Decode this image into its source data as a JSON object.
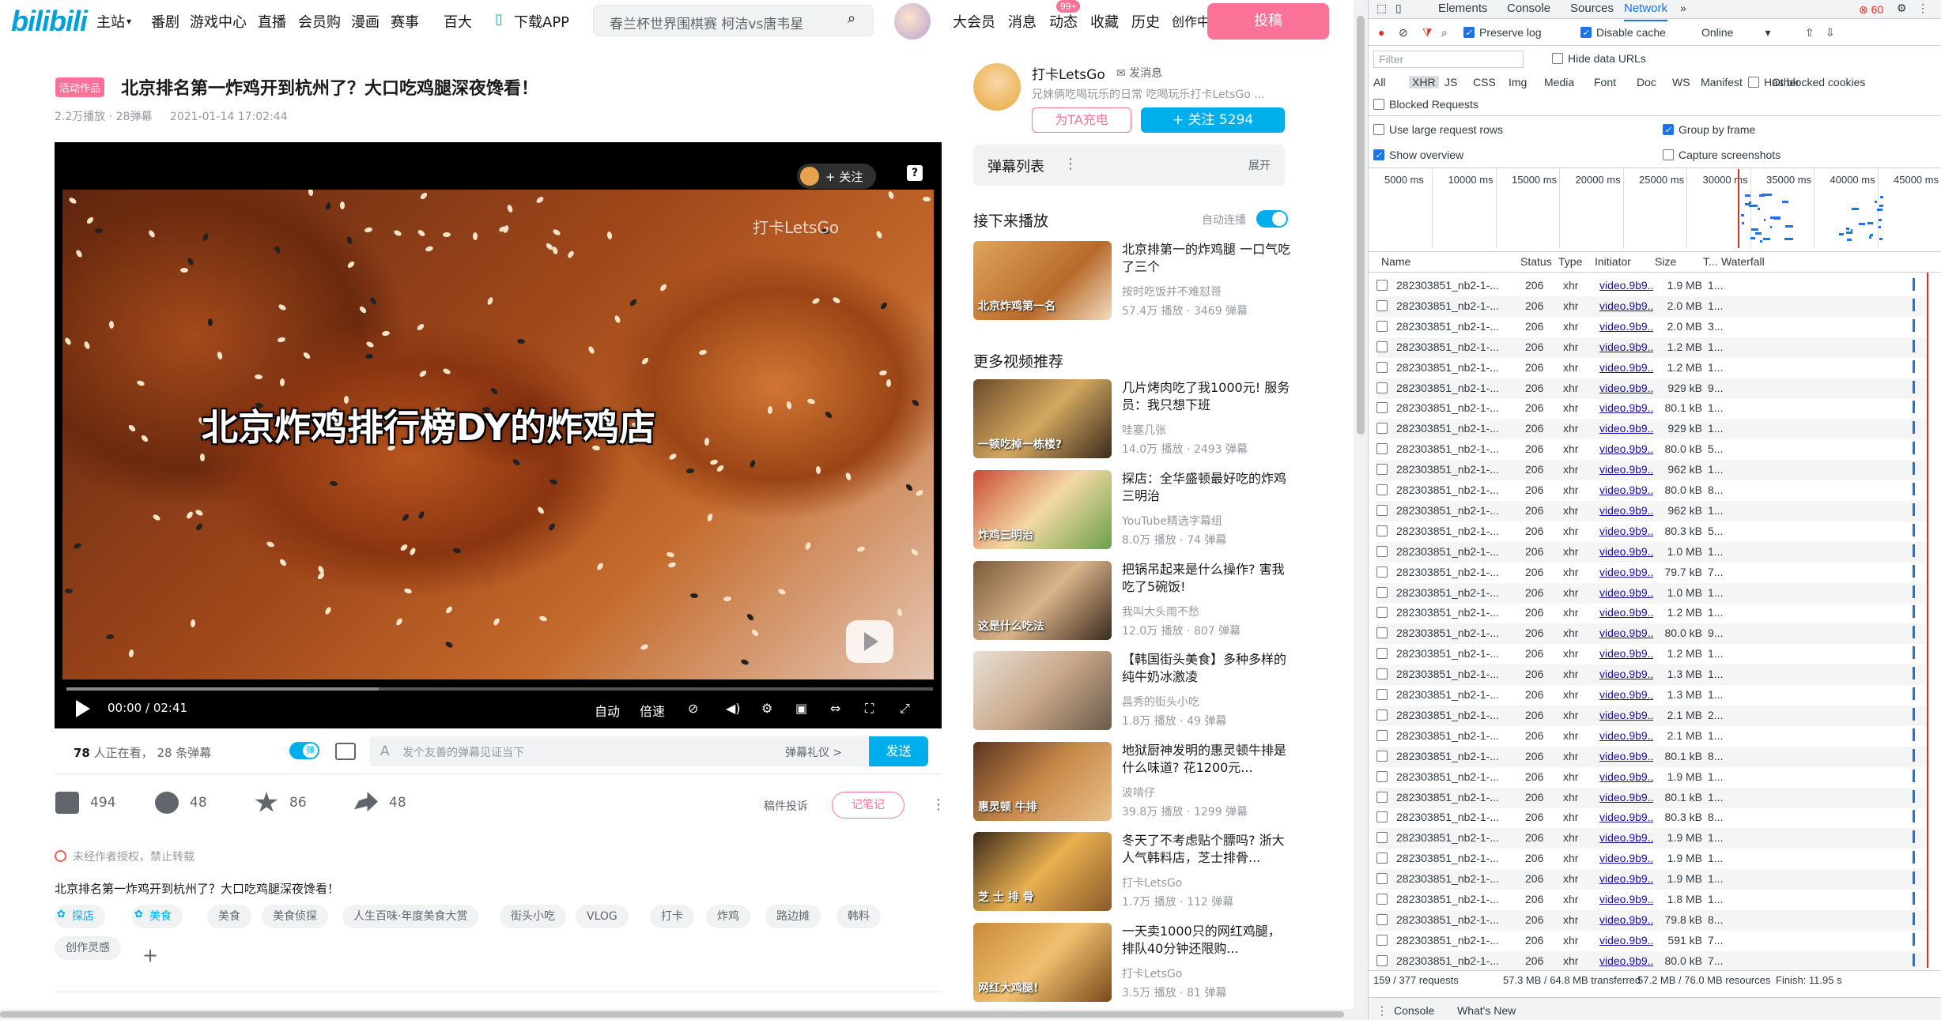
{
  "header": {
    "logo": "bilibili",
    "nav": [
      "主站",
      "番剧",
      "游戏中心",
      "直播",
      "会员购",
      "漫画",
      "赛事",
      "百大",
      "下载APP"
    ],
    "search_placeholder": "春兰杯世界围棋赛 柯洁vs唐韦星",
    "right_nav": [
      "大会员",
      "消息",
      "动态",
      "收藏",
      "历史",
      "创作中心"
    ],
    "dynamic_badge": "99+",
    "post_button": "投稿"
  },
  "video": {
    "activity_tag": "活动作品",
    "title": "北京排名第一炸鸡开到杭州了？大口吃鸡腿深夜馋看！",
    "plays": "2.2万播放",
    "danmaku_count": "28弹幕",
    "date": "2021-01-14 17:02:44",
    "subtitle_text": "北京炸鸡排行榜DY的炸鸡店",
    "watermark": "打卡LetsGo",
    "player_follow": "+ 关注",
    "time_current": "00:00",
    "time_total": "02:41",
    "progress_buffered": 0.36,
    "controls": [
      "自动",
      "倍速"
    ]
  },
  "danmaku_bar": {
    "watching_count": "78",
    "watching_label": "人正在看，",
    "danmaku_total": "28 条弹幕",
    "placeholder": "发个友善的弹幕见证当下",
    "etiquette": "弹幕礼仪 >",
    "send": "发送"
  },
  "actions": {
    "like": "494",
    "coin": "48",
    "favorite": "86",
    "share": "48",
    "report": "稿件投诉",
    "note": "记笔记"
  },
  "copyright_notice": "未经作者授权，禁止转载",
  "description": "北京排名第一炸鸡开到杭州了？大口吃鸡腿深夜馋看！",
  "tags": [
    {
      "label": "探店",
      "blue": true
    },
    {
      "label": "美食",
      "blue": true
    },
    {
      "label": "美食",
      "blue": false
    },
    {
      "label": "美食侦探",
      "blue": false
    },
    {
      "label": "人生百味·年度美食大赏",
      "blue": false
    },
    {
      "label": "街头小吃",
      "blue": false
    },
    {
      "label": "VLOG",
      "blue": false
    },
    {
      "label": "打卡",
      "blue": false
    },
    {
      "label": "炸鸡",
      "blue": false
    },
    {
      "label": "路边摊",
      "blue": false
    },
    {
      "label": "韩料",
      "blue": false
    },
    {
      "label": "创作灵感",
      "blue": false
    }
  ],
  "uploader": {
    "name": "打卡LetsGo",
    "message": "发消息",
    "sign": "兄妹俩吃喝玩乐的日常 吃喝玩乐打卡LetsGo ...",
    "charge": "为TA充电",
    "follow": "+ 关注 5294"
  },
  "danmaku_list": {
    "title": "弹幕列表",
    "expand": "展开"
  },
  "next_up": {
    "heading": "接下来播放",
    "autoplay": "自动连播"
  },
  "more_heading": "更多视频推荐",
  "recommendations": [
    {
      "title": "北京排第一的炸鸡腿 一口气吃了三个",
      "author": "按时吃饭并不难怼哥",
      "stats": "57.4万 播放 · 3469 弹幕",
      "thumb_text": "北京炸鸡第一名"
    },
    {
      "title": "几片烤肉吃了我1000元! 服务员：我只想下班",
      "author": "哇塞几张",
      "stats": "14.0万 播放 · 2493 弹幕",
      "thumb_text": "一顿吃掉一栋楼?"
    },
    {
      "title": "探店：全华盛顿最好吃的炸鸡三明治",
      "author": "YouTube精选字幕组",
      "stats": "8.0万 播放 · 74 弹幕",
      "thumb_text": "炸鸡三明治"
    },
    {
      "title": "把锅吊起来是什么操作? 害我吃了5碗饭!",
      "author": "我叫大头雨不愁",
      "stats": "12.0万 播放 · 807 弹幕",
      "thumb_text": "这是什么吃法"
    },
    {
      "title": "【韩国街头美食】多种多样的纯牛奶冰激凌",
      "author": "昌秀的街头小吃",
      "stats": "1.8万 播放 · 49 弹幕",
      "thumb_text": ""
    },
    {
      "title": "地狱厨神发明的惠灵顿牛排是什么味道? 花1200元...",
      "author": "波啃仔",
      "stats": "39.8万 播放 · 1299 弹幕",
      "thumb_text": "惠灵顿 牛排"
    },
    {
      "title": "冬天了不考虑贴个膘吗? 浙大人气韩料店，芝士排骨...",
      "author": "打卡LetsGo",
      "stats": "1.7万 播放 · 112 弹幕",
      "thumb_text": "芝 士 排 骨"
    },
    {
      "title": "一天卖1000只的网红鸡腿，排队40分钟还限购...",
      "author": "打卡LetsGo",
      "stats": "3.5万 播放 · 81 弹幕",
      "thumb_text": "网红大鸡腿!"
    }
  ],
  "devtools": {
    "tabs": [
      "Elements",
      "Console",
      "Sources",
      "Network"
    ],
    "active_tab": "Network",
    "error_count": "60",
    "preserve_log": "Preserve log",
    "disable_cache": "Disable cache",
    "throttle": "Online",
    "filter_placeholder": "Filter",
    "hide_data_urls": "Hide data URLs",
    "types": [
      "All",
      "XHR",
      "JS",
      "CSS",
      "Img",
      "Media",
      "Font",
      "Doc",
      "WS",
      "Manifest",
      "Other"
    ],
    "has_blocked_cookies": "Has blocked cookies",
    "blocked_requests": "Blocked Requests",
    "large_rows": "Use large request rows",
    "group_by_frame": "Group by frame",
    "show_overview": "Show overview",
    "capture_screenshots": "Capture screenshots",
    "timeline_ticks": [
      "5000 ms",
      "10000 ms",
      "15000 ms",
      "20000 ms",
      "25000 ms",
      "30000 ms",
      "35000 ms",
      "40000 ms",
      "45000 ms"
    ],
    "columns": [
      "Name",
      "Status",
      "Type",
      "Initiator",
      "Size",
      "T...",
      "Waterfall"
    ],
    "rows": [
      {
        "name": "282303851_nb2-1-...",
        "status": "206",
        "type": "xhr",
        "initiator": "video.9b9...",
        "size": "1.9 MB",
        "t": "1..."
      },
      {
        "name": "282303851_nb2-1-...",
        "status": "206",
        "type": "xhr",
        "initiator": "video.9b9...",
        "size": "2.0 MB",
        "t": "1..."
      },
      {
        "name": "282303851_nb2-1-...",
        "status": "206",
        "type": "xhr",
        "initiator": "video.9b9...",
        "size": "2.0 MB",
        "t": "3..."
      },
      {
        "name": "282303851_nb2-1-...",
        "status": "206",
        "type": "xhr",
        "initiator": "video.9b9...",
        "size": "1.2 MB",
        "t": "1..."
      },
      {
        "name": "282303851_nb2-1-...",
        "status": "206",
        "type": "xhr",
        "initiator": "video.9b9...",
        "size": "1.2 MB",
        "t": "1..."
      },
      {
        "name": "282303851_nb2-1-...",
        "status": "206",
        "type": "xhr",
        "initiator": "video.9b9...",
        "size": "929 kB",
        "t": "9..."
      },
      {
        "name": "282303851_nb2-1-...",
        "status": "206",
        "type": "xhr",
        "initiator": "video.9b9...",
        "size": "80.1 kB",
        "t": "1..."
      },
      {
        "name": "282303851_nb2-1-...",
        "status": "206",
        "type": "xhr",
        "initiator": "video.9b9...",
        "size": "929 kB",
        "t": "1..."
      },
      {
        "name": "282303851_nb2-1-...",
        "status": "206",
        "type": "xhr",
        "initiator": "video.9b9...",
        "size": "80.0 kB",
        "t": "5..."
      },
      {
        "name": "282303851_nb2-1-...",
        "status": "206",
        "type": "xhr",
        "initiator": "video.9b9...",
        "size": "962 kB",
        "t": "1..."
      },
      {
        "name": "282303851_nb2-1-...",
        "status": "206",
        "type": "xhr",
        "initiator": "video.9b9...",
        "size": "80.0 kB",
        "t": "8..."
      },
      {
        "name": "282303851_nb2-1-...",
        "status": "206",
        "type": "xhr",
        "initiator": "video.9b9...",
        "size": "962 kB",
        "t": "1..."
      },
      {
        "name": "282303851_nb2-1-...",
        "status": "206",
        "type": "xhr",
        "initiator": "video.9b9...",
        "size": "80.3 kB",
        "t": "5..."
      },
      {
        "name": "282303851_nb2-1-...",
        "status": "206",
        "type": "xhr",
        "initiator": "video.9b9...",
        "size": "1.0 MB",
        "t": "1..."
      },
      {
        "name": "282303851_nb2-1-...",
        "status": "206",
        "type": "xhr",
        "initiator": "video.9b9...",
        "size": "79.7 kB",
        "t": "7..."
      },
      {
        "name": "282303851_nb2-1-...",
        "status": "206",
        "type": "xhr",
        "initiator": "video.9b9...",
        "size": "1.0 MB",
        "t": "1..."
      },
      {
        "name": "282303851_nb2-1-...",
        "status": "206",
        "type": "xhr",
        "initiator": "video.9b9...",
        "size": "1.2 MB",
        "t": "1..."
      },
      {
        "name": "282303851_nb2-1-...",
        "status": "206",
        "type": "xhr",
        "initiator": "video.9b9...",
        "size": "80.0 kB",
        "t": "9..."
      },
      {
        "name": "282303851_nb2-1-...",
        "status": "206",
        "type": "xhr",
        "initiator": "video.9b9...",
        "size": "1.2 MB",
        "t": "1..."
      },
      {
        "name": "282303851_nb2-1-...",
        "status": "206",
        "type": "xhr",
        "initiator": "video.9b9...",
        "size": "1.3 MB",
        "t": "1..."
      },
      {
        "name": "282303851_nb2-1-...",
        "status": "206",
        "type": "xhr",
        "initiator": "video.9b9...",
        "size": "1.3 MB",
        "t": "1..."
      },
      {
        "name": "282303851_nb2-1-...",
        "status": "206",
        "type": "xhr",
        "initiator": "video.9b9...",
        "size": "2.1 MB",
        "t": "2..."
      },
      {
        "name": "282303851_nb2-1-...",
        "status": "206",
        "type": "xhr",
        "initiator": "video.9b9...",
        "size": "2.1 MB",
        "t": "1..."
      },
      {
        "name": "282303851_nb2-1-...",
        "status": "206",
        "type": "xhr",
        "initiator": "video.9b9...",
        "size": "80.1 kB",
        "t": "8..."
      },
      {
        "name": "282303851_nb2-1-...",
        "status": "206",
        "type": "xhr",
        "initiator": "video.9b9...",
        "size": "1.9 MB",
        "t": "1..."
      },
      {
        "name": "282303851_nb2-1-...",
        "status": "206",
        "type": "xhr",
        "initiator": "video.9b9...",
        "size": "80.1 kB",
        "t": "1..."
      },
      {
        "name": "282303851_nb2-1-...",
        "status": "206",
        "type": "xhr",
        "initiator": "video.9b9...",
        "size": "80.3 kB",
        "t": "8..."
      },
      {
        "name": "282303851_nb2-1-...",
        "status": "206",
        "type": "xhr",
        "initiator": "video.9b9...",
        "size": "1.9 MB",
        "t": "1..."
      },
      {
        "name": "282303851_nb2-1-...",
        "status": "206",
        "type": "xhr",
        "initiator": "video.9b9...",
        "size": "1.9 MB",
        "t": "1..."
      },
      {
        "name": "282303851_nb2-1-...",
        "status": "206",
        "type": "xhr",
        "initiator": "video.9b9...",
        "size": "1.9 MB",
        "t": "1..."
      },
      {
        "name": "282303851_nb2-1-...",
        "status": "206",
        "type": "xhr",
        "initiator": "video.9b9...",
        "size": "1.8 MB",
        "t": "1..."
      },
      {
        "name": "282303851_nb2-1-...",
        "status": "206",
        "type": "xhr",
        "initiator": "video.9b9...",
        "size": "79.8 kB",
        "t": "8..."
      },
      {
        "name": "282303851_nb2-1-...",
        "status": "206",
        "type": "xhr",
        "initiator": "video.9b9...",
        "size": "591 kB",
        "t": "7..."
      },
      {
        "name": "282303851_nb2-1-...",
        "status": "206",
        "type": "xhr",
        "initiator": "video.9b9...",
        "size": "80.0 kB",
        "t": "7..."
      }
    ],
    "summary": [
      "159 / 377 requests",
      "57.3 MB / 64.8 MB transferred",
      "57.2 MB / 76.0 MB resources",
      "Finish: 11.95 s"
    ],
    "drawer_tabs": [
      "Console",
      "What's New"
    ],
    "accent": "#1a73e8"
  }
}
